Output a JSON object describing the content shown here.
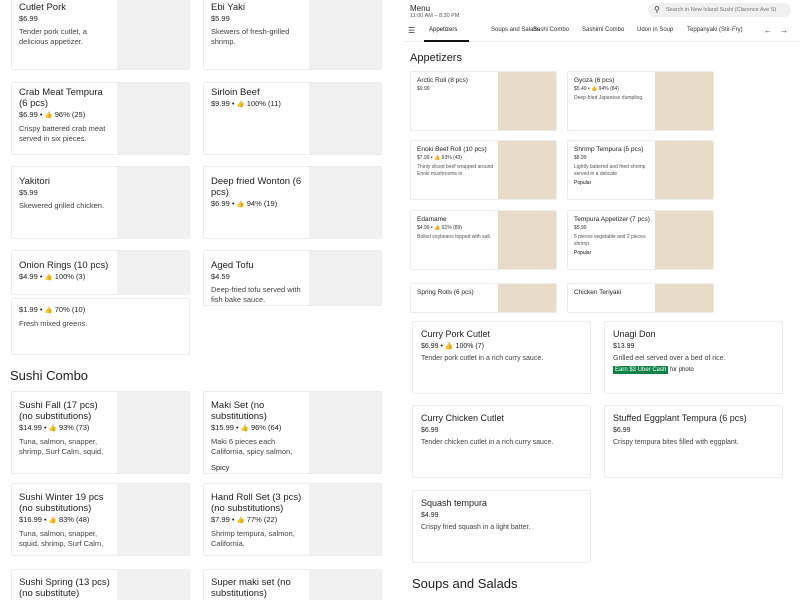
{
  "header": {
    "menu_title": "Menu",
    "hours": "11:00 AM – 8:30 PM",
    "search_placeholder": "Search in New Island Sushi (Clarence Ave S)"
  },
  "tabs": [
    "Appetizers",
    "Soups and Salads",
    "Sushi Combo",
    "Sashimi Combo",
    "Udon in Soup",
    "Teppanyaki (Stir-Fry)"
  ],
  "left_cards": [
    {
      "title": "Cutlet Pork",
      "price": "$6.99",
      "rating": "",
      "desc": "Tender pork cutlet, a delicious appetizer.",
      "tag": ""
    },
    {
      "title": "Ebi Yaki",
      "price": "$5.99",
      "rating": "",
      "desc": "Skewers of fresh-grilled shrimp.",
      "tag": ""
    },
    {
      "title": "Crab Meat Tempura (6 pcs)",
      "price": "$6.99",
      "rating": "96% (25)",
      "desc": "Crispy battered crab meat served in six pieces.",
      "tag": ""
    },
    {
      "title": "Sirloin Beef",
      "price": "$9.99",
      "rating": "100% (11)",
      "desc": "",
      "tag": ""
    },
    {
      "title": "Yakitori",
      "price": "$5.99",
      "rating": "",
      "desc": "Skewered grilled chicken.",
      "tag": ""
    },
    {
      "title": "Deep fried Wonton (6 pcs)",
      "price": "$6.99",
      "rating": "94% (19)",
      "desc": "",
      "tag": ""
    },
    {
      "title": "Onion Rings (10 pcs)",
      "price": "$4.99",
      "rating": "100% (3)",
      "desc": "",
      "tag": ""
    },
    {
      "title": "Aged Tofu",
      "price": "$4.59",
      "rating": "",
      "desc": "Deep-fried tofu served with fish bake sauce.",
      "tag": ""
    },
    {
      "title": "",
      "price": "$1.99",
      "rating": "70% (10)",
      "desc": "Fresh mixed greens.",
      "tag": ""
    },
    {
      "title": "Sushi Fall (17 pcs) (no substitutions)",
      "price": "$14.99",
      "rating": "93% (73)",
      "desc": "Tuna, salmon, snapper, shrimp, Surf Calm, squid,",
      "tag": ""
    },
    {
      "title": "Maki Set  (no substitutions)",
      "price": "$15.99",
      "rating": "96% (64)",
      "desc": "Maki 6 pieces each California, spicy salmon,",
      "tag": "Spicy"
    },
    {
      "title": "Sushi Winter 19 pcs (no substitutions)",
      "price": "$16.99",
      "rating": "83% (48)",
      "desc": "Tuna, salmon, snapper, squid, shrimp, Surf Calm,",
      "tag": ""
    },
    {
      "title": "Hand Roll Set (3 pcs) (no substitutions)",
      "price": "$7.99",
      "rating": "77% (22)",
      "desc": "Shrimp tempura, salmon, California.",
      "tag": ""
    },
    {
      "title": "Sushi Spring (13 pcs) (no substitute)",
      "price": "",
      "rating": "",
      "desc": "",
      "tag": ""
    },
    {
      "title": "Super maki set   (no substitutions)",
      "price": "",
      "rating": "",
      "desc": "",
      "tag": ""
    }
  ],
  "left_section_title": "Sushi Combo",
  "right_section_appetizers": "Appetizers",
  "right_section_soups": "Soups and Salads",
  "small_cards": [
    {
      "title": "Arctic Roll (8 pcs)",
      "price": "$9.99",
      "rating": "",
      "desc": "",
      "popular": ""
    },
    {
      "title": "Gyoza (6 pcs)",
      "price": "$5.49",
      "rating": "94% (84)",
      "desc": "Deep-fried Japanese dumpling.",
      "popular": ""
    },
    {
      "title": "Enoki Beef Roll (10 pcs)",
      "price": "$7.99",
      "rating": "93% (43)",
      "desc": "Thinly sliced beef wrapped around Enoki mushrooms in",
      "popular": ""
    },
    {
      "title": "Shrimp Tempura (5 pcs)",
      "price": "$8.99",
      "rating": "",
      "desc": "Lightly battered and fried shrimp served in a delicate",
      "popular": "Popular"
    },
    {
      "title": "Edamame",
      "price": "$4.99",
      "rating": "91% (89)",
      "desc": "Boiled soybeans topped with salt.",
      "popular": ""
    },
    {
      "title": "Tempura Appetizer (7 pcs)",
      "price": "$5.99",
      "rating": "",
      "desc": "5 pieces vegetable and 2 pieces shrimp.",
      "popular": "Popular"
    },
    {
      "title": "Spring Rolls (6 pcs)",
      "price": "",
      "rating": "",
      "desc": "",
      "popular": ""
    },
    {
      "title": "Chicken Teriyaki",
      "price": "",
      "rating": "",
      "desc": "",
      "popular": ""
    }
  ],
  "big_cards": [
    {
      "title": "Curry Pork Cutlet",
      "price": "$6.99",
      "rating": "100% (7)",
      "desc": "Tender pork cutlet in a rich curry sauce.",
      "promo_hl": "",
      "promo_rest": ""
    },
    {
      "title": "Unagi Don",
      "price": "$13.99",
      "rating": "",
      "desc": "Grilled eel served over a bed of rice.",
      "promo_hl": "Earn $3 Uber Cash",
      "promo_rest": " for photo"
    },
    {
      "title": "Curry Chicken Cutlet",
      "price": "$6.99",
      "rating": "",
      "desc": "Tender chicken cutlet in a rich curry sauce.",
      "promo_hl": "",
      "promo_rest": ""
    },
    {
      "title": "Stuffed Eggplant Tempura (6 pcs)",
      "price": "$6.99",
      "rating": "",
      "desc": "Crispy tempura bites filled with eggplant.",
      "promo_hl": "",
      "promo_rest": ""
    },
    {
      "title": "Squash tempura",
      "price": "$4.99",
      "rating": "",
      "desc": "Crispy fried squash in a light batter.",
      "promo_hl": "",
      "promo_rest": ""
    }
  ],
  "colors": {
    "promo_green": "#0e8345",
    "card_border": "#ececec"
  }
}
